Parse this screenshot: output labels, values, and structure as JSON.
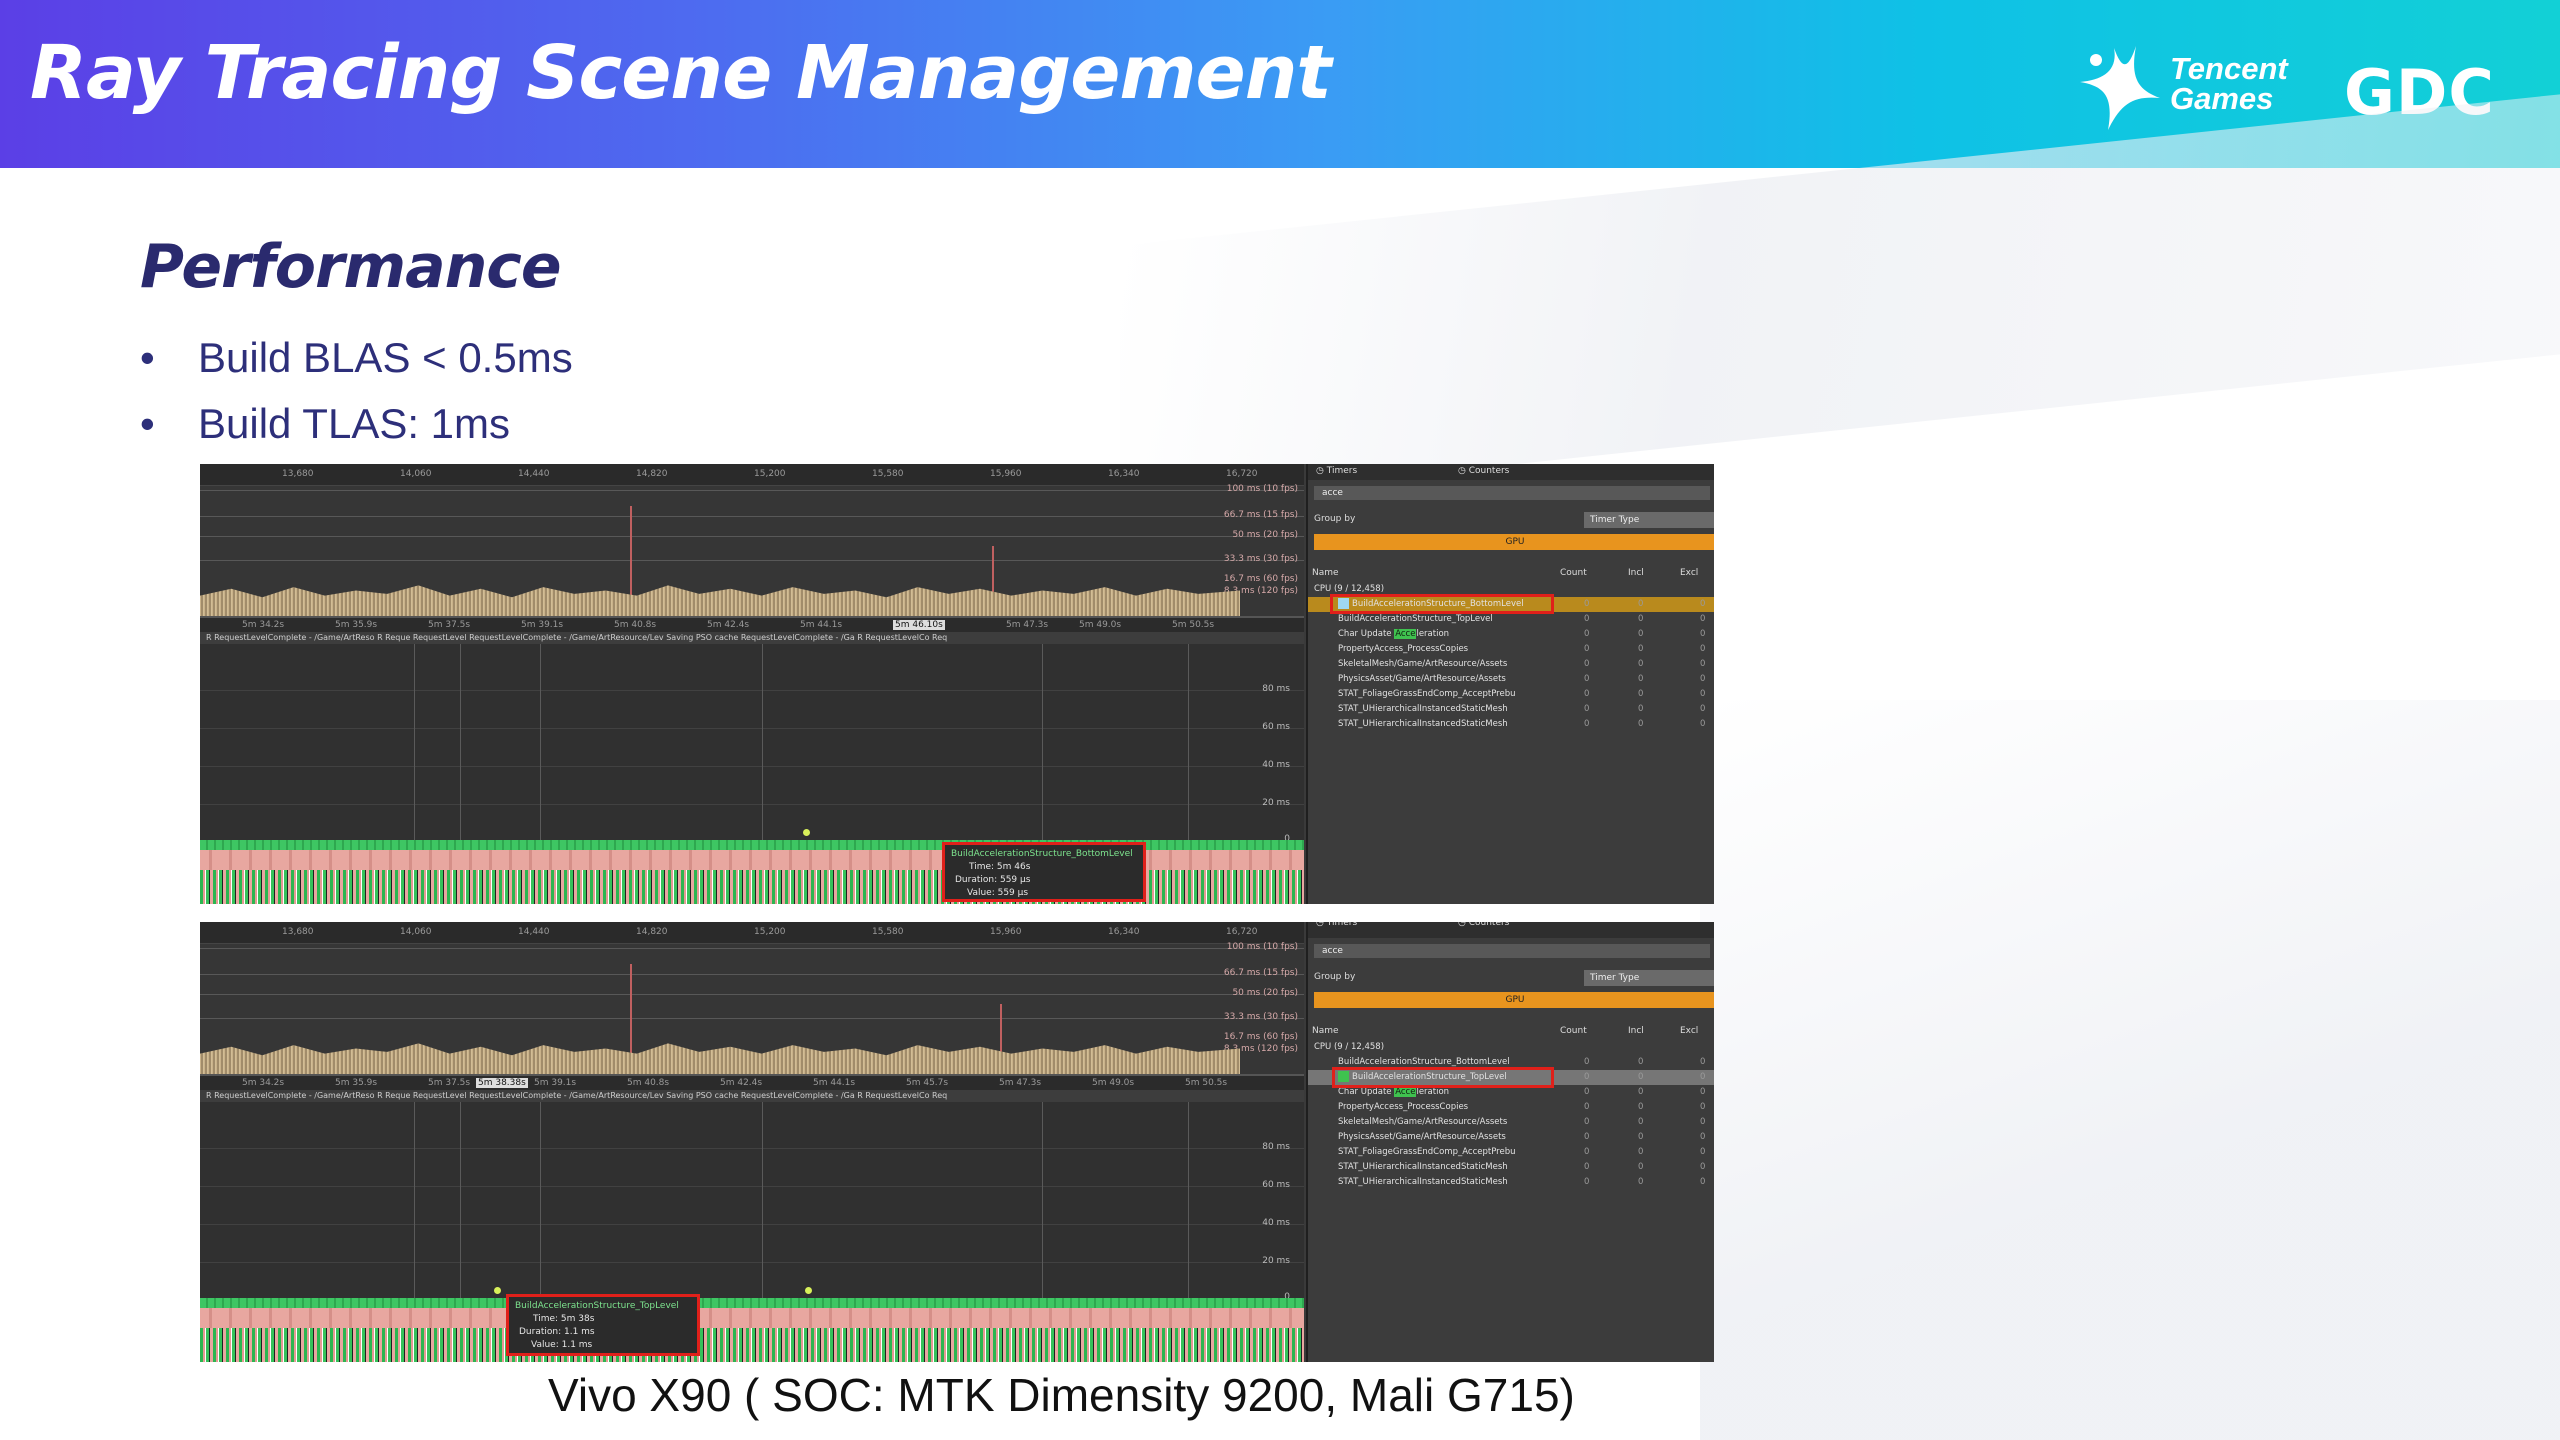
{
  "slide": {
    "title": "Ray Tracing Scene Management",
    "section": "Performance",
    "bullets": [
      "Build BLAS < 0.5ms",
      "Build TLAS: 1ms"
    ],
    "caption": "Vivo X90 ( SOC: MTK Dimensity 9200, Mali G715)"
  },
  "logos": {
    "tencent": [
      "Tencent",
      "Games"
    ],
    "gdc": "GDC"
  },
  "colors": {
    "banner_start": "#5b3fe6",
    "banner_end": "#12d0d6",
    "title_navy": "#2a2a6e",
    "highlight_red": "#e0201a",
    "gpu_orange": "#e8941e"
  },
  "timeline": {
    "frame_ticks": [
      "13,680",
      "14,060",
      "14,440",
      "14,820",
      "15,200",
      "15,580",
      "15,960",
      "16,340",
      "16,720"
    ],
    "fps_labels": [
      "100 ms (10 fps)",
      "66.7 ms (15 fps)",
      "50 ms (20 fps)",
      "33.3 ms (30 fps)",
      "16.7 ms (60 fps)",
      "8.3 ms (120 fps)"
    ],
    "ms_labels": [
      "80 ms",
      "60 ms",
      "40 ms",
      "20 ms",
      "0"
    ],
    "track_text": "R RequestLevelComplete - /Game/ArtReso  R  Reque  RequestLevel RequestLevelComplete - /Game/ArtResource/Lev  Saving PSO cache                                          RequestLevelComplete - /Ga  R  RequestLevelCo  Req",
    "top": {
      "time_ticks": [
        "5m 34.2s",
        "5m 35.9s",
        "5m 37.5s",
        "5m 39.1s",
        "5m 40.8s",
        "5m 42.4s",
        "5m 44.1s",
        "5m 46.10s",
        "5m 47.3s",
        "5m 49.0s",
        "5m 50.5s"
      ],
      "tooltip": {
        "name": "BuildAccelerationStructure_BottomLevel",
        "time": "Time: 5m 46s",
        "duration": "Duration: 559 µs",
        "value": "Value: 559 µs"
      }
    },
    "bottom": {
      "time_ticks": [
        "5m 34.2s",
        "5m 35.9s",
        "5m 37.5s",
        "5m 38.38s",
        "5m 39.1s",
        "5m 40.8s",
        "5m 42.4s",
        "5m 44.1s",
        "5m 45.7s",
        "5m 47.3s",
        "5m 49.0s",
        "5m 50.5s"
      ],
      "tooltip": {
        "name": "BuildAccelerationStructure_TopLevel",
        "time": "Time: 5m 38s",
        "duration": "Duration: 1.1 ms",
        "value": "Value: 1.1 ms"
      }
    }
  },
  "timers_panel": {
    "tabs": [
      "Timers",
      "Counters"
    ],
    "search": "acce",
    "group_by_label": "Group by",
    "group_by_value": "Timer Type",
    "gpu_label": "GPU",
    "columns": [
      "Name",
      "Count",
      "Incl",
      "Excl"
    ],
    "root": "CPU (9 / 12,458)",
    "rows": [
      {
        "name": "BuildAccelerationStructure_BottomLevel",
        "count": "0",
        "incl": "0",
        "excl": "0"
      },
      {
        "name": "BuildAccelerationStructure_TopLevel",
        "count": "0",
        "incl": "0",
        "excl": "0"
      },
      {
        "name_prefix": "Char Update ",
        "name_match": "Acce",
        "name_suffix": "leration",
        "count": "0",
        "incl": "0",
        "excl": "0"
      },
      {
        "name": "PropertyAccess_ProcessCopies",
        "count": "0",
        "incl": "0",
        "excl": "0"
      },
      {
        "name": "SkeletalMesh/Game/ArtResource/Assets",
        "count": "0",
        "incl": "0",
        "excl": "0"
      },
      {
        "name": "PhysicsAsset/Game/ArtResource/Assets",
        "count": "0",
        "incl": "0",
        "excl": "0"
      },
      {
        "name": "STAT_FoliageGrassEndComp_AcceptPrebu",
        "count": "0",
        "incl": "0",
        "excl": "0"
      },
      {
        "name": "STAT_UHierarchicalInstancedStaticMesh",
        "count": "0",
        "incl": "0",
        "excl": "0"
      },
      {
        "name": "STAT_UHierarchicalInstancedStaticMesh",
        "count": "0",
        "incl": "0",
        "excl": "0"
      }
    ]
  }
}
